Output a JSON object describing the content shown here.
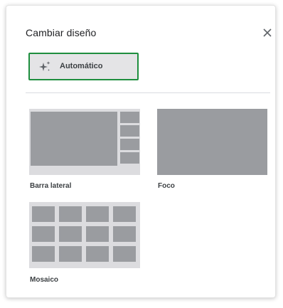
{
  "dialog": {
    "title": "Cambiar diseño",
    "close_icon": "close-icon"
  },
  "auto_button": {
    "label": "Automático",
    "icon": "sparkle-icon",
    "selected": true,
    "accent_color": "#1e8e3e"
  },
  "layouts": [
    {
      "label": "Barra lateral",
      "icon": "sidebar-layout-thumbnail"
    },
    {
      "label": "Foco",
      "icon": "spotlight-layout-thumbnail"
    },
    {
      "label": "Mosaico",
      "icon": "tiled-layout-thumbnail"
    }
  ]
}
